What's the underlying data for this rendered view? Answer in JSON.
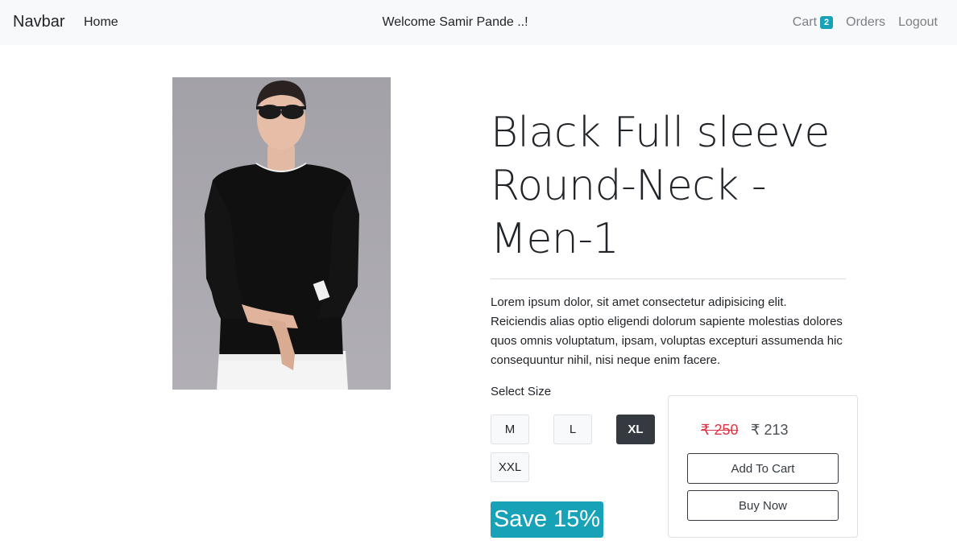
{
  "navbar": {
    "brand": "Navbar",
    "home": "Home",
    "welcome": "Welcome Samir Pande ..!",
    "cart_label": "Cart",
    "cart_count": "2",
    "orders": "Orders",
    "logout": "Logout"
  },
  "product": {
    "title": "Black Full sleeve Round-Neck - Men-1",
    "description": "Lorem ipsum dolor, sit amet consectetur adipisicing elit. Reiciendis alias optio eligendi dolorum sapiente molestias dolores quos omnis voluptatum, ipsam, voluptas excepturi assumenda hic consequuntur nihil, nisi neque enim facere.",
    "select_size_label": "Select Size",
    "sizes": [
      "M",
      "L",
      "XL",
      "XXL"
    ],
    "selected_size": "XL",
    "save_label": "Save 15%"
  },
  "pricing": {
    "original_price": "₹ 250",
    "discounted_price": "₹ 213",
    "add_to_cart": "Add To Cart",
    "buy_now": "Buy Now"
  },
  "colors": {
    "accent": "#17a2b8",
    "dark": "#343a40",
    "strike_price": "#dc3545"
  }
}
